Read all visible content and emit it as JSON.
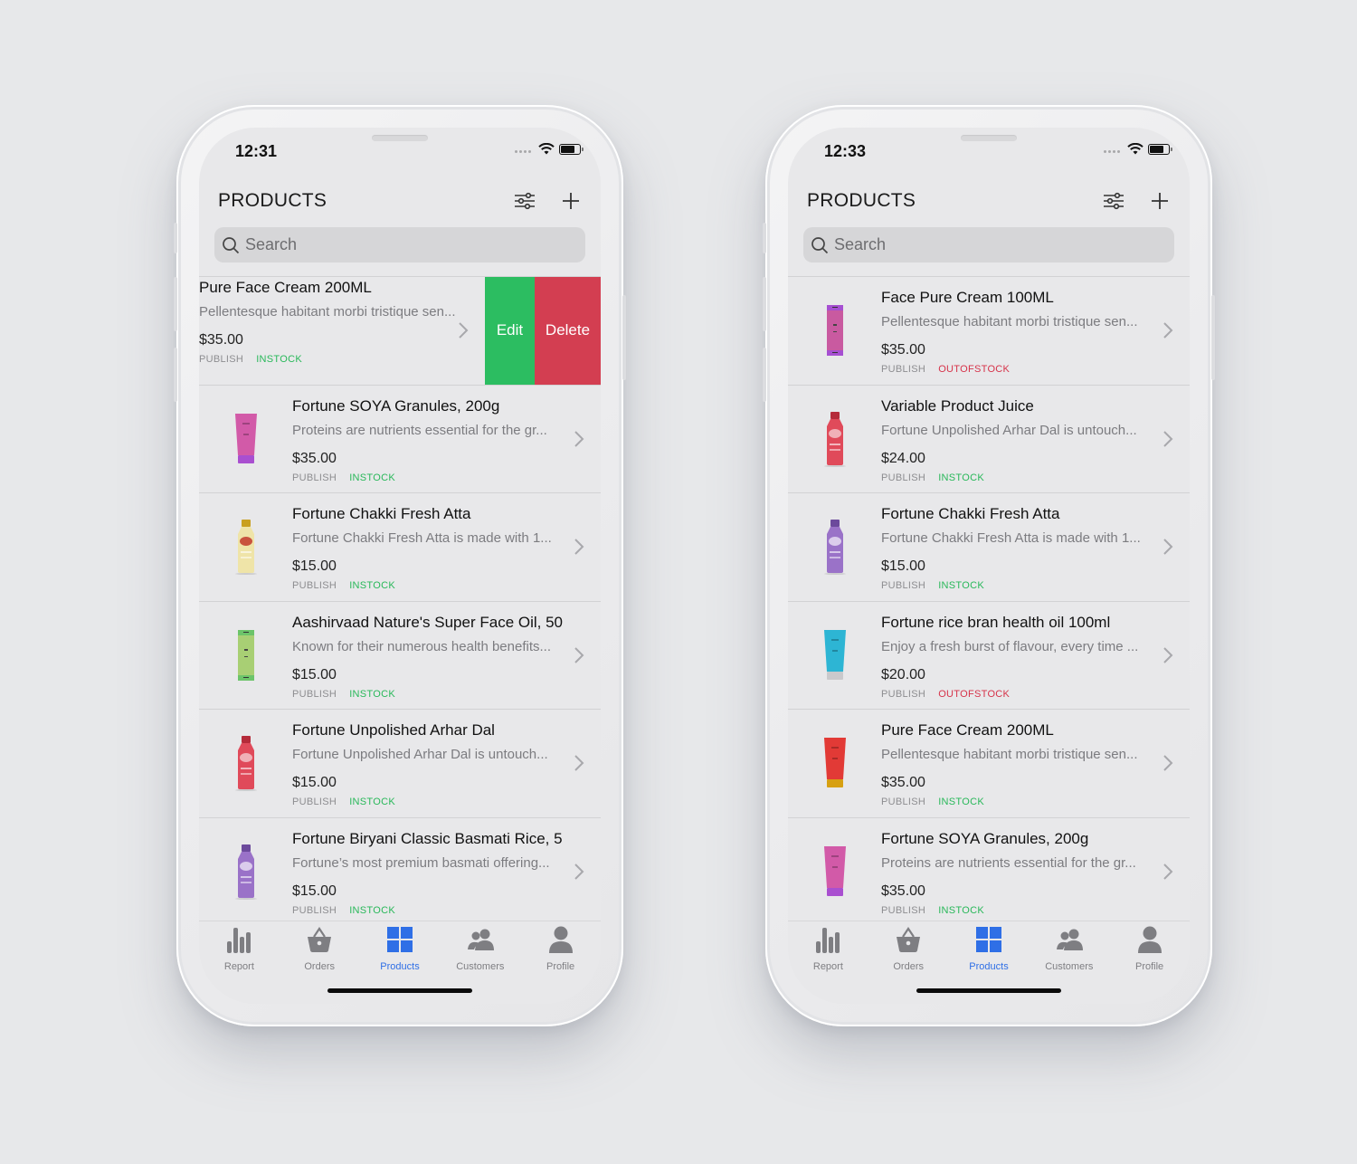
{
  "colors": {
    "accent": "#2f6fe6",
    "instock": "#29b85a",
    "outofstock": "#d6334a",
    "edit": "#2cbd61",
    "delete": "#d33e51"
  },
  "phones": [
    {
      "status_time": "12:31",
      "title": "PRODUCTS",
      "filter_icon": "sliders-icon",
      "add_icon": "plus-icon",
      "search_placeholder": "Search",
      "swiped_row": {
        "name": "Pure Face Cream 200ML",
        "visible_name": "e Face Cream 200ML",
        "desc": "Pellentesque habitant morbi tristique sen...",
        "visible_desc": "entesque habitant morbi tristique sen...",
        "price": "$35.00",
        "visible_price": "5.00",
        "status": "PUBLISH",
        "visible_status": "LISH",
        "stock": "INSTOCK",
        "edit_label": "Edit",
        "delete_label": "Delete"
      },
      "products": [
        {
          "name": "Fortune SOYA Granules, 200g",
          "desc": "Proteins are nutrients essential for the gr...",
          "price": "$35.00",
          "status": "PUBLISH",
          "stock": "INSTOCK",
          "thumb": "pink-tube"
        },
        {
          "name": "Fortune Chakki Fresh Atta",
          "desc": "Fortune Chakki Fresh Atta is made with 1...",
          "price": "$15.00",
          "status": "PUBLISH",
          "stock": "INSTOCK",
          "thumb": "cream-bottle"
        },
        {
          "name": "Aashirvaad Nature's Super Face Oil, 50",
          "desc": "Known for their numerous health benefits...",
          "price": "$15.00",
          "status": "PUBLISH",
          "stock": "INSTOCK",
          "thumb": "green-box"
        },
        {
          "name": "Fortune Unpolished Arhar Dal",
          "desc": "Fortune Unpolished Arhar Dal is untouch...",
          "price": "$15.00",
          "status": "PUBLISH",
          "stock": "INSTOCK",
          "thumb": "red-bottle"
        },
        {
          "name": "Fortune Biryani Classic Basmati Rice, 5",
          "desc": "Fortune’s most premium basmati offering...",
          "price": "$15.00",
          "status": "PUBLISH",
          "stock": "INSTOCK",
          "thumb": "purple-bottle"
        }
      ],
      "tabs": [
        {
          "label": "Report",
          "icon": "bar-chart-icon",
          "active": false
        },
        {
          "label": "Orders",
          "icon": "basket-icon",
          "active": false
        },
        {
          "label": "Products",
          "icon": "grid-icon",
          "active": true
        },
        {
          "label": "Customers",
          "icon": "users-icon",
          "active": false
        },
        {
          "label": "Profile",
          "icon": "user-icon",
          "active": false
        }
      ]
    },
    {
      "status_time": "12:33",
      "title": "PRODUCTS",
      "filter_icon": "sliders-icon",
      "add_icon": "plus-icon",
      "search_placeholder": "Search",
      "products": [
        {
          "name": "Face Pure Cream 100ML",
          "desc": "Pellentesque habitant morbi tristique sen...",
          "price": "$35.00",
          "status": "PUBLISH",
          "stock": "OUTOFSTOCK",
          "thumb": "magenta-box"
        },
        {
          "name": "Variable Product Juice",
          "desc": "Fortune Unpolished Arhar Dal is untouch...",
          "price": "$24.00",
          "status": "PUBLISH",
          "stock": "INSTOCK",
          "thumb": "red-bottle"
        },
        {
          "name": "Fortune Chakki Fresh Atta",
          "desc": "Fortune Chakki Fresh Atta is made with 1...",
          "price": "$15.00",
          "status": "PUBLISH",
          "stock": "INSTOCK",
          "thumb": "purple-bottle"
        },
        {
          "name": "Fortune rice bran health oil 100ml",
          "desc": "Enjoy a fresh burst of flavour, every time ...",
          "price": "$20.00",
          "status": "PUBLISH",
          "stock": "OUTOFSTOCK",
          "thumb": "blue-tube"
        },
        {
          "name": "Pure Face Cream 200ML",
          "desc": "Pellentesque habitant morbi tristique sen...",
          "price": "$35.00",
          "status": "PUBLISH",
          "stock": "INSTOCK",
          "thumb": "red-tube"
        },
        {
          "name": "Fortune SOYA Granules, 200g",
          "desc": "Proteins are nutrients essential for the gr...",
          "price": "$35.00",
          "status": "PUBLISH",
          "stock": "INSTOCK",
          "thumb": "pink-tube"
        }
      ],
      "tabs": [
        {
          "label": "Report",
          "icon": "bar-chart-icon",
          "active": false
        },
        {
          "label": "Orders",
          "icon": "basket-icon",
          "active": false
        },
        {
          "label": "Products",
          "icon": "grid-icon",
          "active": true
        },
        {
          "label": "Customers",
          "icon": "users-icon",
          "active": false
        },
        {
          "label": "Profile",
          "icon": "user-icon",
          "active": false
        }
      ]
    }
  ]
}
